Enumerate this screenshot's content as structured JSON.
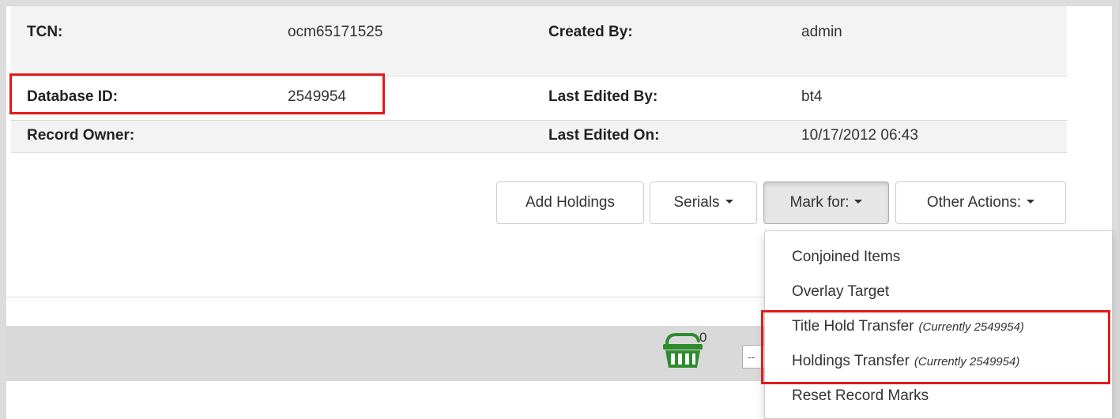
{
  "summary": {
    "tcn_label": "TCN:",
    "tcn_value": "ocm65171525",
    "created_by_label": "Created By:",
    "created_by_value": "admin",
    "database_id_label": "Database ID:",
    "database_id_value": "2549954",
    "last_edited_by_label": "Last Edited By:",
    "last_edited_by_value": "bt4",
    "record_owner_label": "Record Owner:",
    "record_owner_value": "",
    "last_edited_on_label": "Last Edited On:",
    "last_edited_on_value": "10/17/2012 06:43"
  },
  "actions": {
    "add_holdings": "Add Holdings",
    "serials": "Serials",
    "mark_for": "Mark for:",
    "other_actions": "Other Actions:"
  },
  "mark_for_menu": {
    "items": [
      {
        "label": "Conjoined Items",
        "note": ""
      },
      {
        "label": "Overlay Target",
        "note": ""
      },
      {
        "label": "Title Hold Transfer",
        "note": "(Currently 2549954)"
      },
      {
        "label": "Holdings Transfer",
        "note": "(Currently 2549954)"
      },
      {
        "label": "Reset Record Marks",
        "note": ""
      }
    ]
  },
  "basket": {
    "count": "0",
    "icon": "basket-icon",
    "select_value": "--"
  },
  "colors": {
    "annotation_red": "#e11b1b",
    "basket_green": "#2e8b2e"
  }
}
